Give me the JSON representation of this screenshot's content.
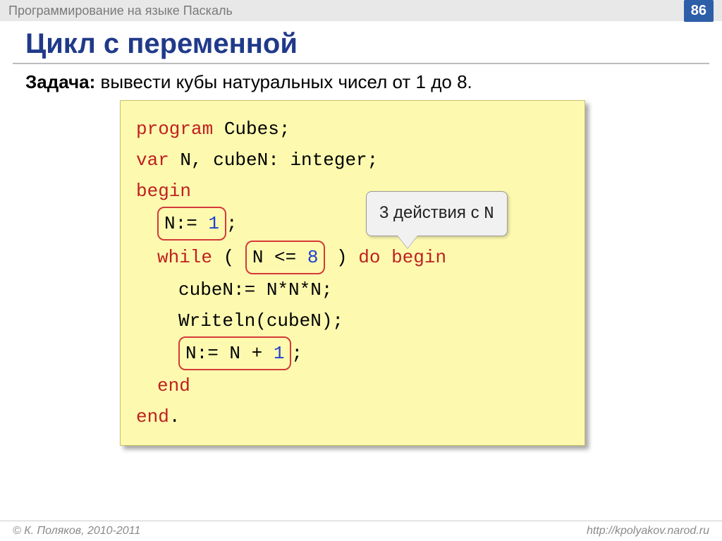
{
  "header": {
    "course_title": "Программирование на языке Паскаль",
    "page_number": "86"
  },
  "slide": {
    "title": "Цикл с переменной",
    "task_label": "Задача:",
    "task_text": " вывести кубы натуральных чисел от 1 до 8."
  },
  "callout": {
    "prefix": "3 действия с ",
    "var": "N"
  },
  "code": {
    "l1_kw": "program",
    "l1_rest": " Cubes;",
    "l2_kw": "var",
    "l2_rest": " N, cubeN: integer;",
    "l3_kw": "begin",
    "l4_lhs": "N:= ",
    "l4_num": "1",
    "l4_end": ";",
    "l5_kw1": "while",
    "l5_open": " ( ",
    "l5_cond_var": "N <= ",
    "l5_cond_num": "8",
    "l5_close": " ) ",
    "l5_kw2": "do begin",
    "l6": "cubeN:= N*N*N;",
    "l7": "Writeln(cubeN);",
    "l8_lhs": "N:= N + ",
    "l8_num": "1",
    "l8_end": ";",
    "l9_kw": "end",
    "l10_kw": "end",
    "l10_dot": "."
  },
  "footer": {
    "copyright": "© К. Поляков, 2010-2011",
    "url": "http://kpolyakov.narod.ru"
  }
}
